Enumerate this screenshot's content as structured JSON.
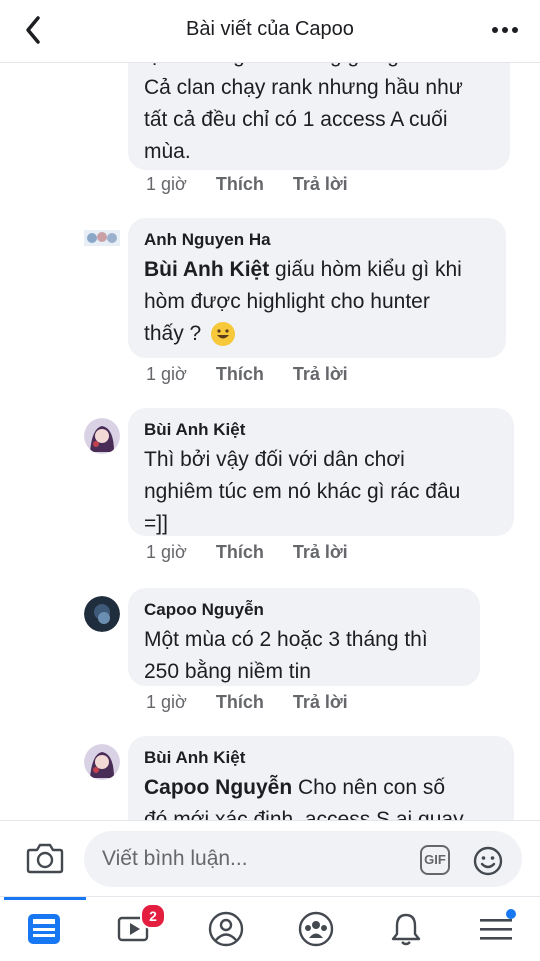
{
  "header": {
    "title": "Bài viết của Capoo"
  },
  "comments": [
    {
      "text_partial_top": "lệ NL đang lên không giống nhau.",
      "lines": [
        "Cả clan chạy rank nhưng hầu như",
        "tất cả đều chỉ có 1 access A cuối",
        "mùa."
      ],
      "time": "1 giờ",
      "like": "Thích",
      "reply": "Trả lời"
    },
    {
      "author": "Anh Nguyen Ha",
      "mention": "Bùi Anh Kiệt",
      "line1_rest": " giấu hòm kiểu gì khi",
      "line2": "hòm được highlight cho hunter",
      "line3": "thấy ? ",
      "time": "1 giờ",
      "like": "Thích",
      "reply": "Trả lời"
    },
    {
      "author": "Bùi Anh Kiệt",
      "lines": [
        "Thì bởi vậy đối với dân chơi",
        "nghiêm túc em nó khác gì rác đâu",
        "=]]"
      ],
      "time": "1 giờ",
      "like": "Thích",
      "reply": "Trả lời"
    },
    {
      "author": "Capoo Nguyễn",
      "lines": [
        "Một mùa có 2 hoặc 3 tháng thì",
        "250 bằng niềm tin"
      ],
      "time": "1 giờ",
      "like": "Thích",
      "reply": "Trả lời"
    },
    {
      "author": "Bùi Anh Kiệt",
      "mention": "Capoo Nguyễn",
      "line1_rest": " Cho nên con số",
      "line2": "đó mới xác định, access S ai quay"
    }
  ],
  "composer": {
    "placeholder": "Viết bình luận..."
  },
  "tabbar": {
    "video_badge": "2"
  },
  "colors": {
    "accent": "#1877f2",
    "bubble": "#f0f2f5",
    "badge": "#e41e3f"
  }
}
